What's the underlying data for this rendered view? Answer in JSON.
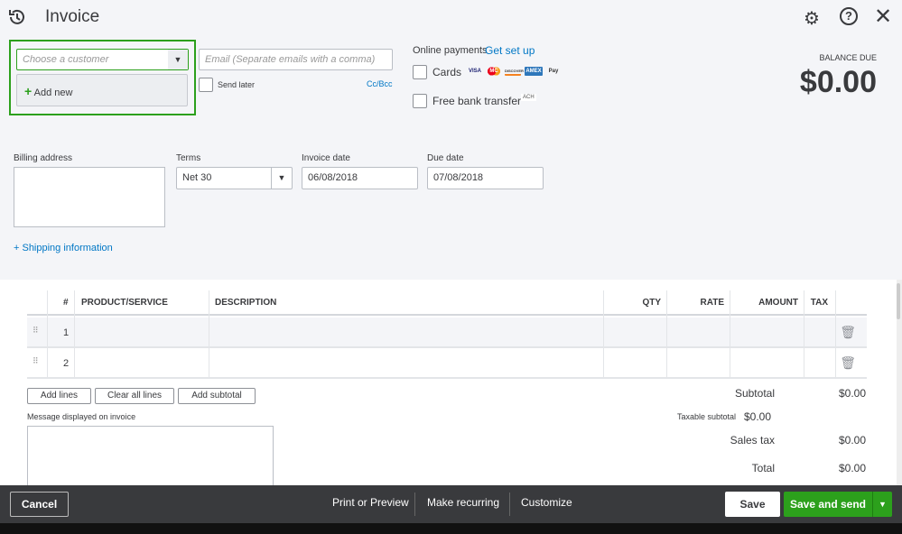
{
  "header": {
    "title": "Invoice"
  },
  "customer": {
    "placeholder": "Choose a customer",
    "add_new": "Add new"
  },
  "email": {
    "placeholder": "Email (Separate emails with a comma)",
    "send_later": "Send later",
    "cc_bcc": "Cc/Bcc"
  },
  "payments": {
    "label": "Online payments",
    "setup": "Get set up",
    "cards": "Cards",
    "card_brands": [
      "VISA",
      "MC",
      "DISCOVER",
      "AMEX",
      "Pay"
    ],
    "bank": "Free bank transfer",
    "ach": "ACH"
  },
  "balance": {
    "label": "BALANCE DUE",
    "amount": "$0.00"
  },
  "billing": {
    "label": "Billing address",
    "shipping": "+ Shipping information"
  },
  "terms": {
    "label": "Terms",
    "value": "Net 30"
  },
  "invoice_date": {
    "label": "Invoice date",
    "value": "06/08/2018"
  },
  "due_date": {
    "label": "Due date",
    "value": "07/08/2018"
  },
  "table": {
    "headers": {
      "num": "#",
      "product": "PRODUCT/SERVICE",
      "description": "DESCRIPTION",
      "qty": "QTY",
      "rate": "RATE",
      "amount": "AMOUNT",
      "tax": "TAX"
    },
    "rows": [
      "1",
      "2"
    ]
  },
  "line_buttons": {
    "add": "Add lines",
    "clear": "Clear all lines",
    "subtotal": "Add subtotal"
  },
  "message": {
    "label": "Message displayed on invoice"
  },
  "totals": {
    "subtotal_label": "Subtotal",
    "subtotal": "$0.00",
    "taxable_label": "Taxable subtotal",
    "taxable": "$0.00",
    "tax_label": "Sales tax",
    "tax": "$0.00",
    "total_label": "Total",
    "total": "$0.00"
  },
  "footer": {
    "cancel": "Cancel",
    "print": "Print or Preview",
    "recurring": "Make recurring",
    "customize": "Customize",
    "save": "Save",
    "save_send": "Save and send"
  },
  "colors": {
    "green": "#2ca01c",
    "blue": "#0077c5",
    "footer": "#393a3d"
  }
}
